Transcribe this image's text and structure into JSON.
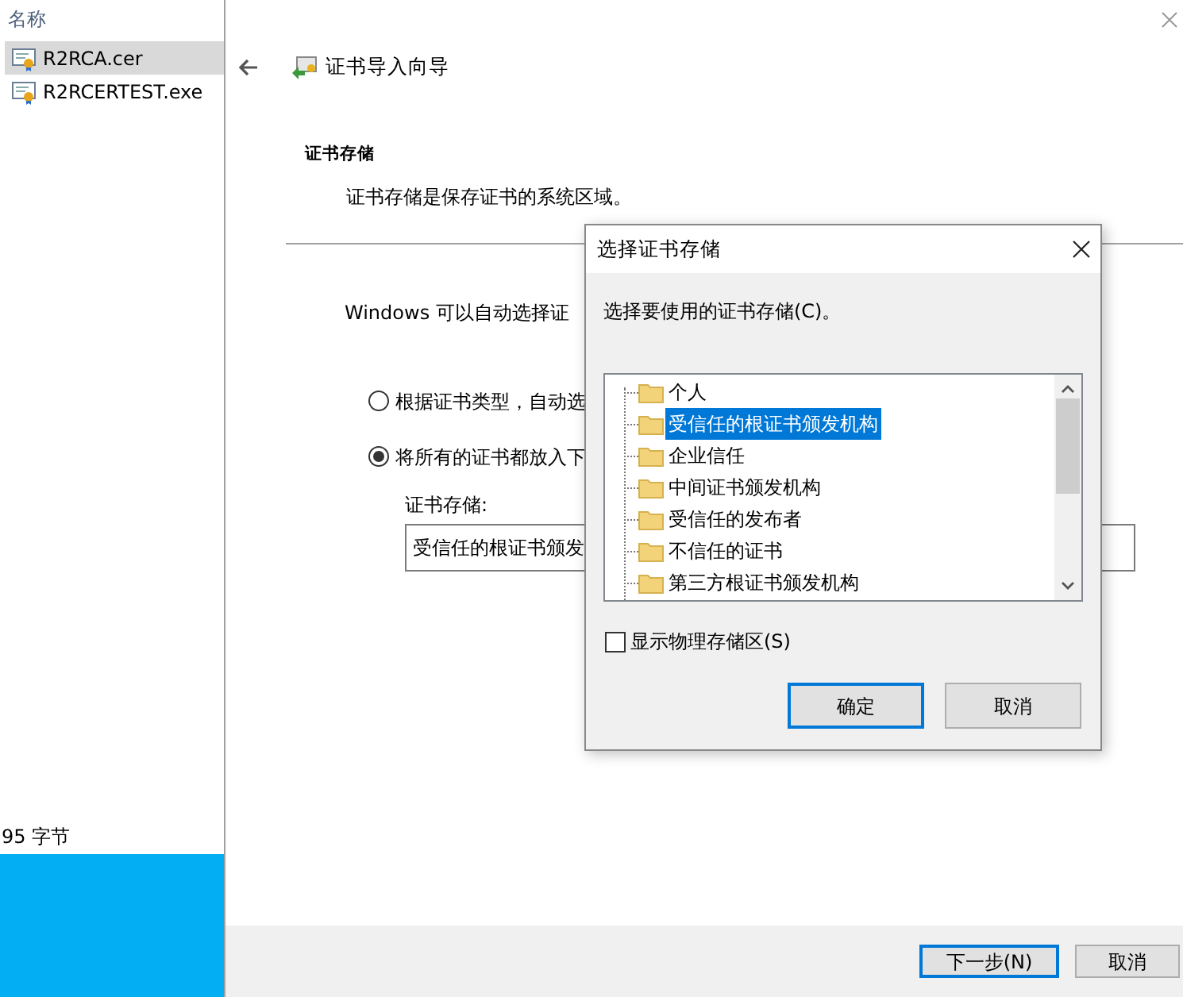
{
  "explorer": {
    "column_header": "名称",
    "files": [
      {
        "name": "R2RCA.cer",
        "selected": true
      },
      {
        "name": "R2RCERTEST.exe",
        "selected": false
      }
    ],
    "status": "95 字节"
  },
  "wizard": {
    "title": "证书导入向导",
    "section_title": "证书存储",
    "section_description": "证书存储是保存证书的系统区域。",
    "intro": "Windows 可以自动选择证",
    "options": [
      {
        "label": "根据证书类型，自动选",
        "selected": false
      },
      {
        "label": "将所有的证书都放入下",
        "selected": true
      }
    ],
    "store_label": "证书存储:",
    "store_value": "受信任的根证书颁发",
    "buttons": [
      {
        "label": "下一步(N)",
        "default": true
      },
      {
        "label": "取消",
        "default": false
      }
    ]
  },
  "dialog": {
    "title": "选择证书存储",
    "prompt": "选择要使用的证书存储(C)。",
    "stores": [
      {
        "name": "个人",
        "selected": false
      },
      {
        "name": "受信任的根证书颁发机构",
        "selected": true
      },
      {
        "name": "企业信任",
        "selected": false
      },
      {
        "name": "中间证书颁发机构",
        "selected": false
      },
      {
        "name": "受信任的发布者",
        "selected": false
      },
      {
        "name": "不信任的证书",
        "selected": false
      },
      {
        "name": "第三方根证书颁发机构",
        "selected": false
      }
    ],
    "show_physical": {
      "label": "显示物理存储区(S)",
      "checked": false
    },
    "buttons": [
      {
        "label": "确定",
        "default": true
      },
      {
        "label": "取消",
        "default": false
      }
    ]
  }
}
